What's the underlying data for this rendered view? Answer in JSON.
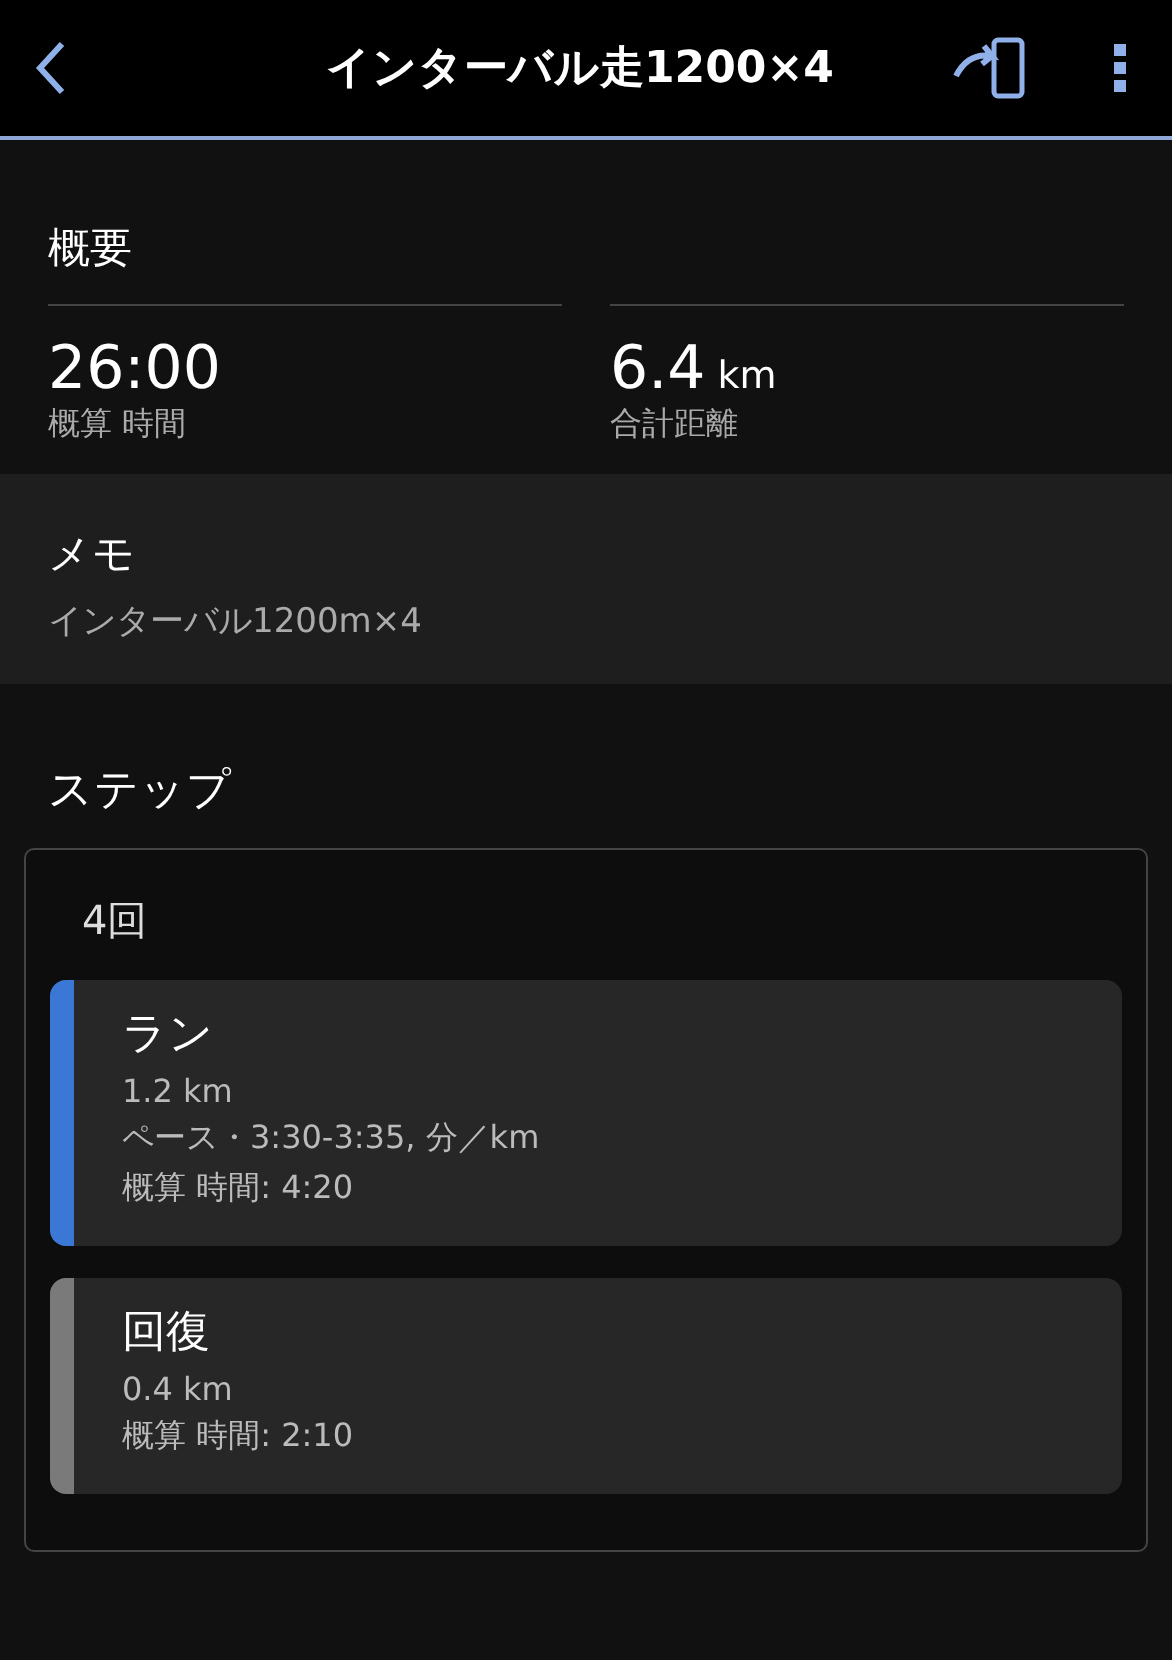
{
  "header": {
    "title": "インターバル走1200×4"
  },
  "overview": {
    "title": "概要",
    "stats": [
      {
        "value": "26:00",
        "label": "概算 時間"
      },
      {
        "value": "6.4",
        "unit": "km",
        "label": "合計距離"
      }
    ]
  },
  "memo": {
    "title": "メモ",
    "text": "インターバル1200m×4"
  },
  "steps": {
    "title": "ステップ",
    "repeat": {
      "label": "4回",
      "items": [
        {
          "name": "ラン",
          "color": "#3b78d6",
          "lines": [
            "1.2 km",
            "ペース・3:30-3:35, 分／km",
            "概算 時間: 4:20"
          ]
        },
        {
          "name": "回復",
          "color": "#7a7a7a",
          "lines": [
            "0.4 km",
            "概算 時間: 2:10"
          ]
        }
      ]
    }
  }
}
